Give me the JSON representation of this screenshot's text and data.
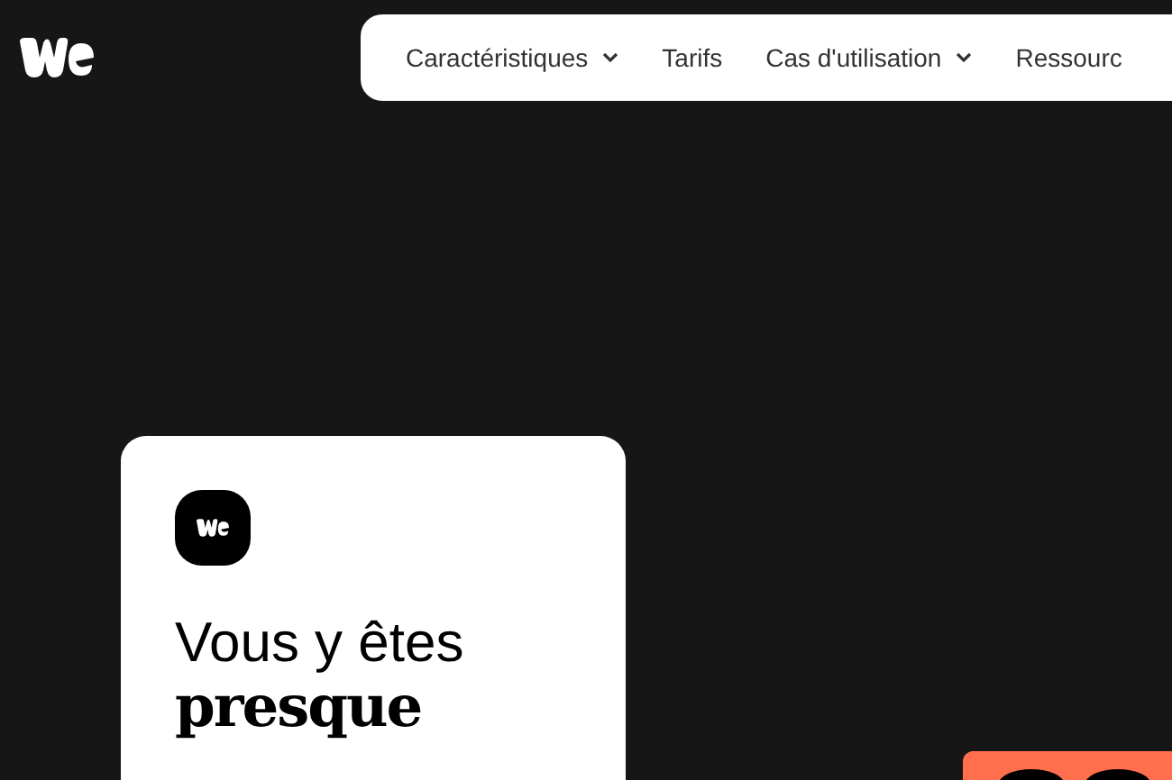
{
  "nav": {
    "items": [
      {
        "label": "Caractéristiques",
        "has_menu": true
      },
      {
        "label": "Tarifs",
        "has_menu": false
      },
      {
        "label": "Cas d'utilisation",
        "has_menu": true
      },
      {
        "label": "Ressourc",
        "has_menu": false
      }
    ]
  },
  "card": {
    "heading": "Vous y êtes **presque**"
  }
}
